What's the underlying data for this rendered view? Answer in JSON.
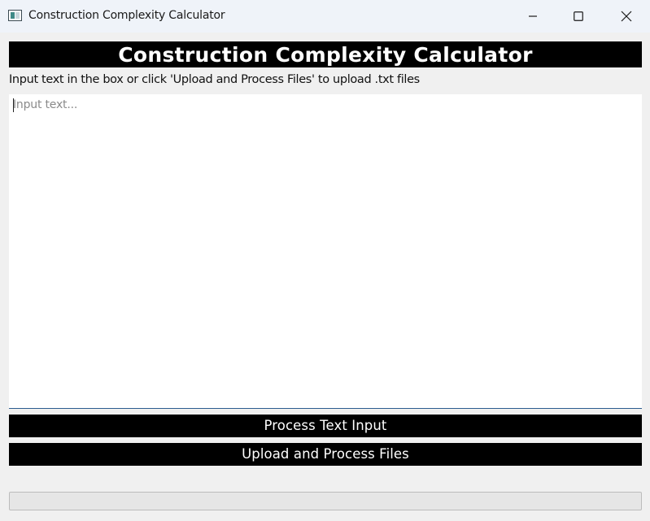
{
  "window": {
    "title": "Construction Complexity Calculator",
    "icon": "app-window-icon",
    "controls": [
      "minimize-icon",
      "maximize-icon",
      "close-icon"
    ]
  },
  "header": {
    "title": "Construction Complexity Calculator"
  },
  "instructions": "Input text in the box or click 'Upload and Process Files' to upload .txt files",
  "input": {
    "value": "",
    "placeholder": "Input text..."
  },
  "buttons": {
    "process_label": "Process Text Input",
    "upload_label": "Upload and Process Files"
  },
  "progress": {
    "value": 0
  },
  "colors": {
    "banner_bg": "#000000",
    "banner_fg": "#ffffff",
    "window_bg": "#f0f0f0",
    "titlebar_bg": "#eff3f9",
    "input_focus_border": "#2c5c8f"
  }
}
